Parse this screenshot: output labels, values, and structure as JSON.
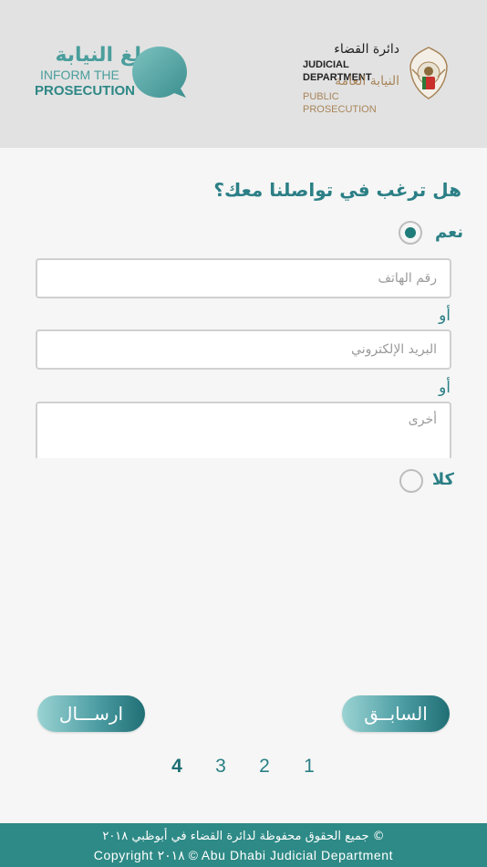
{
  "header": {
    "inform_logo": {
      "arabic": "بلغ النيابة",
      "english_line1": "INFORM THE",
      "english_line2": "PROSECUTION"
    },
    "jd_logo": {
      "arabic_line1": "دائرة القضاء",
      "english_line1": "JUDICIAL DEPARTMENT",
      "arabic_line2": "النيابة العامة",
      "english_line2": "PUBLIC PROSECUTION"
    }
  },
  "form": {
    "question": "هل ترغب في تواصلنا معك؟",
    "yes_label": "نعم",
    "yes_selected": true,
    "phone_placeholder": "رقم الهاتف",
    "or_label_1": "أو",
    "email_placeholder": "البريد الإلكتروني",
    "or_label_2": "أو",
    "other_placeholder": "أخرى",
    "no_label": "كلا",
    "no_selected": false
  },
  "buttons": {
    "send_label": "ارســـال",
    "previous_label": "السابــق"
  },
  "pagination": {
    "pages": [
      "1",
      "2",
      "3",
      "4"
    ],
    "current": "4"
  },
  "footer": {
    "line1": "© جميع الحقوق محفوظة لدائرة القضاء في أبوظبي ٢٠١٨",
    "line2": "Copyright ٢٠١٨ © Abu Dhabi Judicial Department"
  },
  "colors": {
    "accent": "#2b7f86",
    "footer_bg": "#2e8a86",
    "header_bg": "#e2e2e2",
    "gold": "#a8855a"
  },
  "icons": {
    "inform_logo_icon": "speech-bubble-icon",
    "jd_logo_icon": "falcon-emblem-icon"
  }
}
